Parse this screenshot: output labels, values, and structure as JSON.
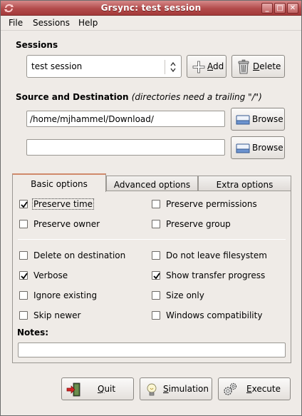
{
  "window": {
    "title": "Grsync: test session",
    "controls": {
      "minimize": "_",
      "maximize": "□",
      "close": "✕"
    }
  },
  "menu": {
    "file": "File",
    "sessions": "Sessions",
    "help": "Help"
  },
  "sessions": {
    "label": "Sessions",
    "selected": "test session",
    "add_label": "Add",
    "delete_label": "Delete"
  },
  "source_dest": {
    "label": "Source and Destination",
    "hint": "(directories need a trailing \"/\")",
    "source_value": "/home/mjhammel/Download/",
    "destination_value": "",
    "browse_label": "Browse"
  },
  "tabs": [
    "Basic options",
    "Advanced options",
    "Extra options"
  ],
  "options": {
    "preserve_time": {
      "label": "Preserve time",
      "checked": true
    },
    "preserve_permissions": {
      "label": "Preserve permissions",
      "checked": false
    },
    "preserve_owner": {
      "label": "Preserve owner",
      "checked": false
    },
    "preserve_group": {
      "label": "Preserve group",
      "checked": false
    },
    "delete_on_destination": {
      "label": "Delete on destination",
      "checked": false
    },
    "do_not_leave_filesystem": {
      "label": "Do not leave filesystem",
      "checked": false
    },
    "verbose": {
      "label": "Verbose",
      "checked": true
    },
    "show_transfer_progress": {
      "label": "Show transfer progress",
      "checked": true
    },
    "ignore_existing": {
      "label": "Ignore existing",
      "checked": false
    },
    "size_only": {
      "label": "Size only",
      "checked": false
    },
    "skip_newer": {
      "label": "Skip newer",
      "checked": false
    },
    "windows_compatibility": {
      "label": "Windows compatibility",
      "checked": false
    }
  },
  "notes": {
    "label": "Notes:",
    "value": ""
  },
  "actions": {
    "quit": "Quit",
    "simulation": "Simulation",
    "execute": "Execute"
  }
}
